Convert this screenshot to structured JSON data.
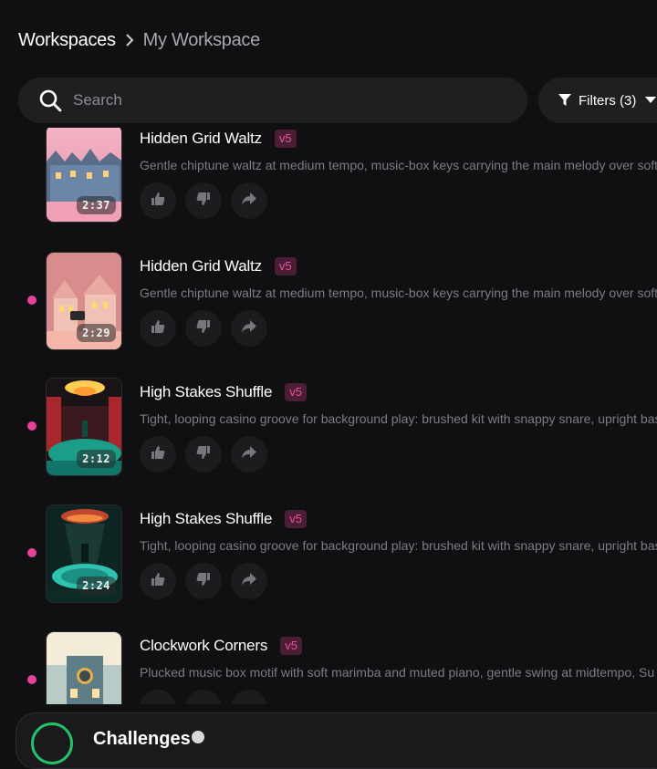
{
  "breadcrumb": {
    "root": "Workspaces",
    "current": "My Workspace"
  },
  "search": {
    "placeholder": "Search"
  },
  "filters": {
    "label": "Filters (3)"
  },
  "songs": [
    {
      "title": "Hidden Grid Waltz",
      "version": "v5",
      "duration": "2:37",
      "description": "Gentle chiptune waltz at medium tempo, music-box keys carrying the main melody over soft",
      "unread": false
    },
    {
      "title": "Hidden Grid Waltz",
      "version": "v5",
      "duration": "2:29",
      "description": "Gentle chiptune waltz at medium tempo, music-box keys carrying the main melody over soft",
      "unread": true
    },
    {
      "title": "High Stakes Shuffle",
      "version": "v5",
      "duration": "2:12",
      "description": "Tight, looping casino groove for background play: brushed kit with snappy snare, upright bass",
      "unread": true
    },
    {
      "title": "High Stakes Shuffle",
      "version": "v5",
      "duration": "2:24",
      "description": "Tight, looping casino groove for background play: brushed kit with snappy snare, upright bass",
      "unread": true
    },
    {
      "title": "Clockwork Corners",
      "version": "v5",
      "duration": "",
      "description": "Plucked music box motif with soft marimba and muted piano, gentle swing at midtempo, Su",
      "unread": true
    }
  ],
  "bottom_bar": {
    "label": "Challenges"
  },
  "colors": {
    "accent": "#e8409a",
    "badge_bg": "#4a1f35",
    "badge_text": "#ef4f9e",
    "progress_ring": "#25c06a"
  }
}
